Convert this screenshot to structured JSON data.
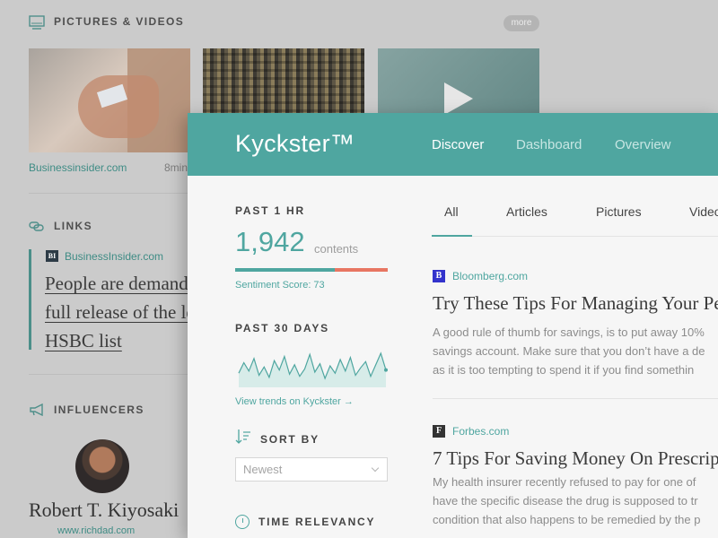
{
  "background": {
    "pictures_section": {
      "title": "PICTURES & VIDEOS",
      "more_label": "more",
      "icon": "image-icon"
    },
    "thumbnail_caption": {
      "source": "Businessinsider.com",
      "time": "8min"
    },
    "links_section": {
      "title": "LINKS",
      "icon": "link-icon",
      "badge": "BI",
      "source": "BusinessInsider.com",
      "quote_lines": [
        "People are demand",
        "full release of the le",
        "HSBC list"
      ]
    },
    "influencers_section": {
      "title": "INFLUENCERS",
      "icon": "megaphone-icon",
      "name": "Robert T. Kiyosaki",
      "url": "www.richdad.com"
    }
  },
  "app": {
    "brand": "Kyckster™",
    "nav": [
      "Discover",
      "Dashboard",
      "Overview"
    ],
    "nav_active": "Discover",
    "accent_color": "#4fa6a0",
    "negative_color": "#e87662"
  },
  "stats": {
    "past_hr_label": "PAST 1 HR",
    "count": "1,942",
    "count_unit": "contents",
    "sentiment_label": "Sentiment Score: 73",
    "sentiment_score": 0.65,
    "past_30_label": "PAST 30 DAYS",
    "trend_values": [
      12,
      22,
      14,
      26,
      10,
      18,
      8,
      24,
      15,
      28,
      11,
      20,
      9,
      16,
      30,
      13,
      21,
      7,
      19,
      12,
      25,
      14,
      27,
      10,
      17,
      23,
      9,
      20,
      31,
      15
    ],
    "trend_link": "View trends on Kyckster →"
  },
  "sort": {
    "label": "SORT BY",
    "selected": "Newest",
    "icon": "sort-icon"
  },
  "time_relevancy": {
    "label": "TIME RELEVANCY",
    "icon": "clock-icon"
  },
  "tabs": [
    "All",
    "Articles",
    "Pictures",
    "Video"
  ],
  "tab_active": "All",
  "articles": [
    {
      "badge": "B",
      "badge_color": "#3333cc",
      "source": "Bloomberg.com",
      "title": "Try These Tips For Managing Your Pe",
      "lines": [
        "A good rule of thumb for savings, is to put away 10%",
        "savings account. Make sure that you don’t have a de",
        "as it is too tempting to spend it if you find somethin"
      ]
    },
    {
      "badge": "F",
      "badge_color": "#333333",
      "source": "Forbes.com",
      "title": "7 Tips For Saving Money On Prescrip",
      "lines": [
        "My health insurer recently refused to pay for one of",
        "have the specific disease the drug is supposed to tr",
        "condition that also happens to be remedied by the p"
      ]
    }
  ]
}
